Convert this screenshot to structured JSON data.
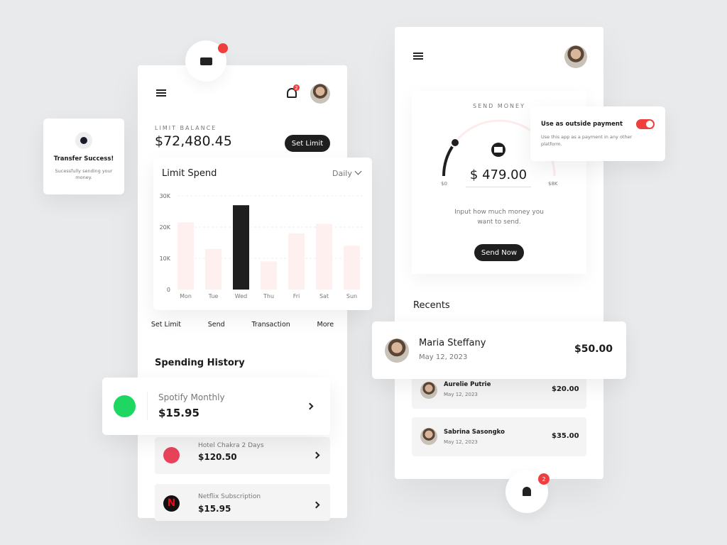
{
  "colors": {
    "accent": "#ef3e3e",
    "dark": "#1f1f1f",
    "bar_light": "#fdf0ee"
  },
  "toast": {
    "title": "Transfer Success!",
    "message": "Sucessfully sending your money.",
    "icon": "check-circle-icon"
  },
  "wallet": {
    "limit_label": "LIMIT BALANCE",
    "balance": "$72,480.45",
    "set_limit": "Set Limit",
    "bell_badge": "2"
  },
  "chart_card": {
    "title": "Limit Spend",
    "period": "Daily"
  },
  "chart_data": {
    "type": "bar",
    "categories": [
      "Mon",
      "Tue",
      "Wed",
      "Thu",
      "Fri",
      "Sat",
      "Sun"
    ],
    "values": [
      21500,
      13000,
      27000,
      9000,
      18000,
      21000,
      14000
    ],
    "highlight": "Wed",
    "yticks": [
      "0",
      "10K",
      "20K",
      "30K"
    ],
    "ylim": [
      0,
      30000
    ],
    "grid": true
  },
  "actions": [
    {
      "label": "Set Limit"
    },
    {
      "label": "Send"
    },
    {
      "label": "Transaction"
    },
    {
      "label": "More"
    }
  ],
  "history": {
    "title": "Spending History",
    "items": [
      {
        "name": "Spotify Monthly",
        "amount": "$15.95",
        "logo": "spotify"
      },
      {
        "name": "Hotel Chakra 2 Days",
        "amount": "$120.50",
        "logo": "airbnb"
      },
      {
        "name": "Netflix Subscription",
        "amount": "$15.95",
        "logo": "netflix"
      }
    ]
  },
  "send": {
    "label": "SEND MONEY",
    "amount": "$ 479.00",
    "min": "$0",
    "max": "$8K",
    "value_fraction": 0.06,
    "hint": "Input how much money you want to send.",
    "button": "Send Now"
  },
  "outside_payment": {
    "title": "Use as outside payment",
    "desc": "Use this app as a payment in any other platform.",
    "enabled": true
  },
  "recents": {
    "title": "Recents",
    "items": [
      {
        "name": "Maria Steffany",
        "date": "May 12, 2023",
        "amount": "$50.00"
      },
      {
        "name": "Aurelie Putrie",
        "date": "May 12, 2023",
        "amount": "$20.00"
      },
      {
        "name": "Sabrina Sasongko",
        "date": "May 12, 2023",
        "amount": "$35.00"
      }
    ]
  },
  "floating_bell": {
    "badge": "2"
  }
}
